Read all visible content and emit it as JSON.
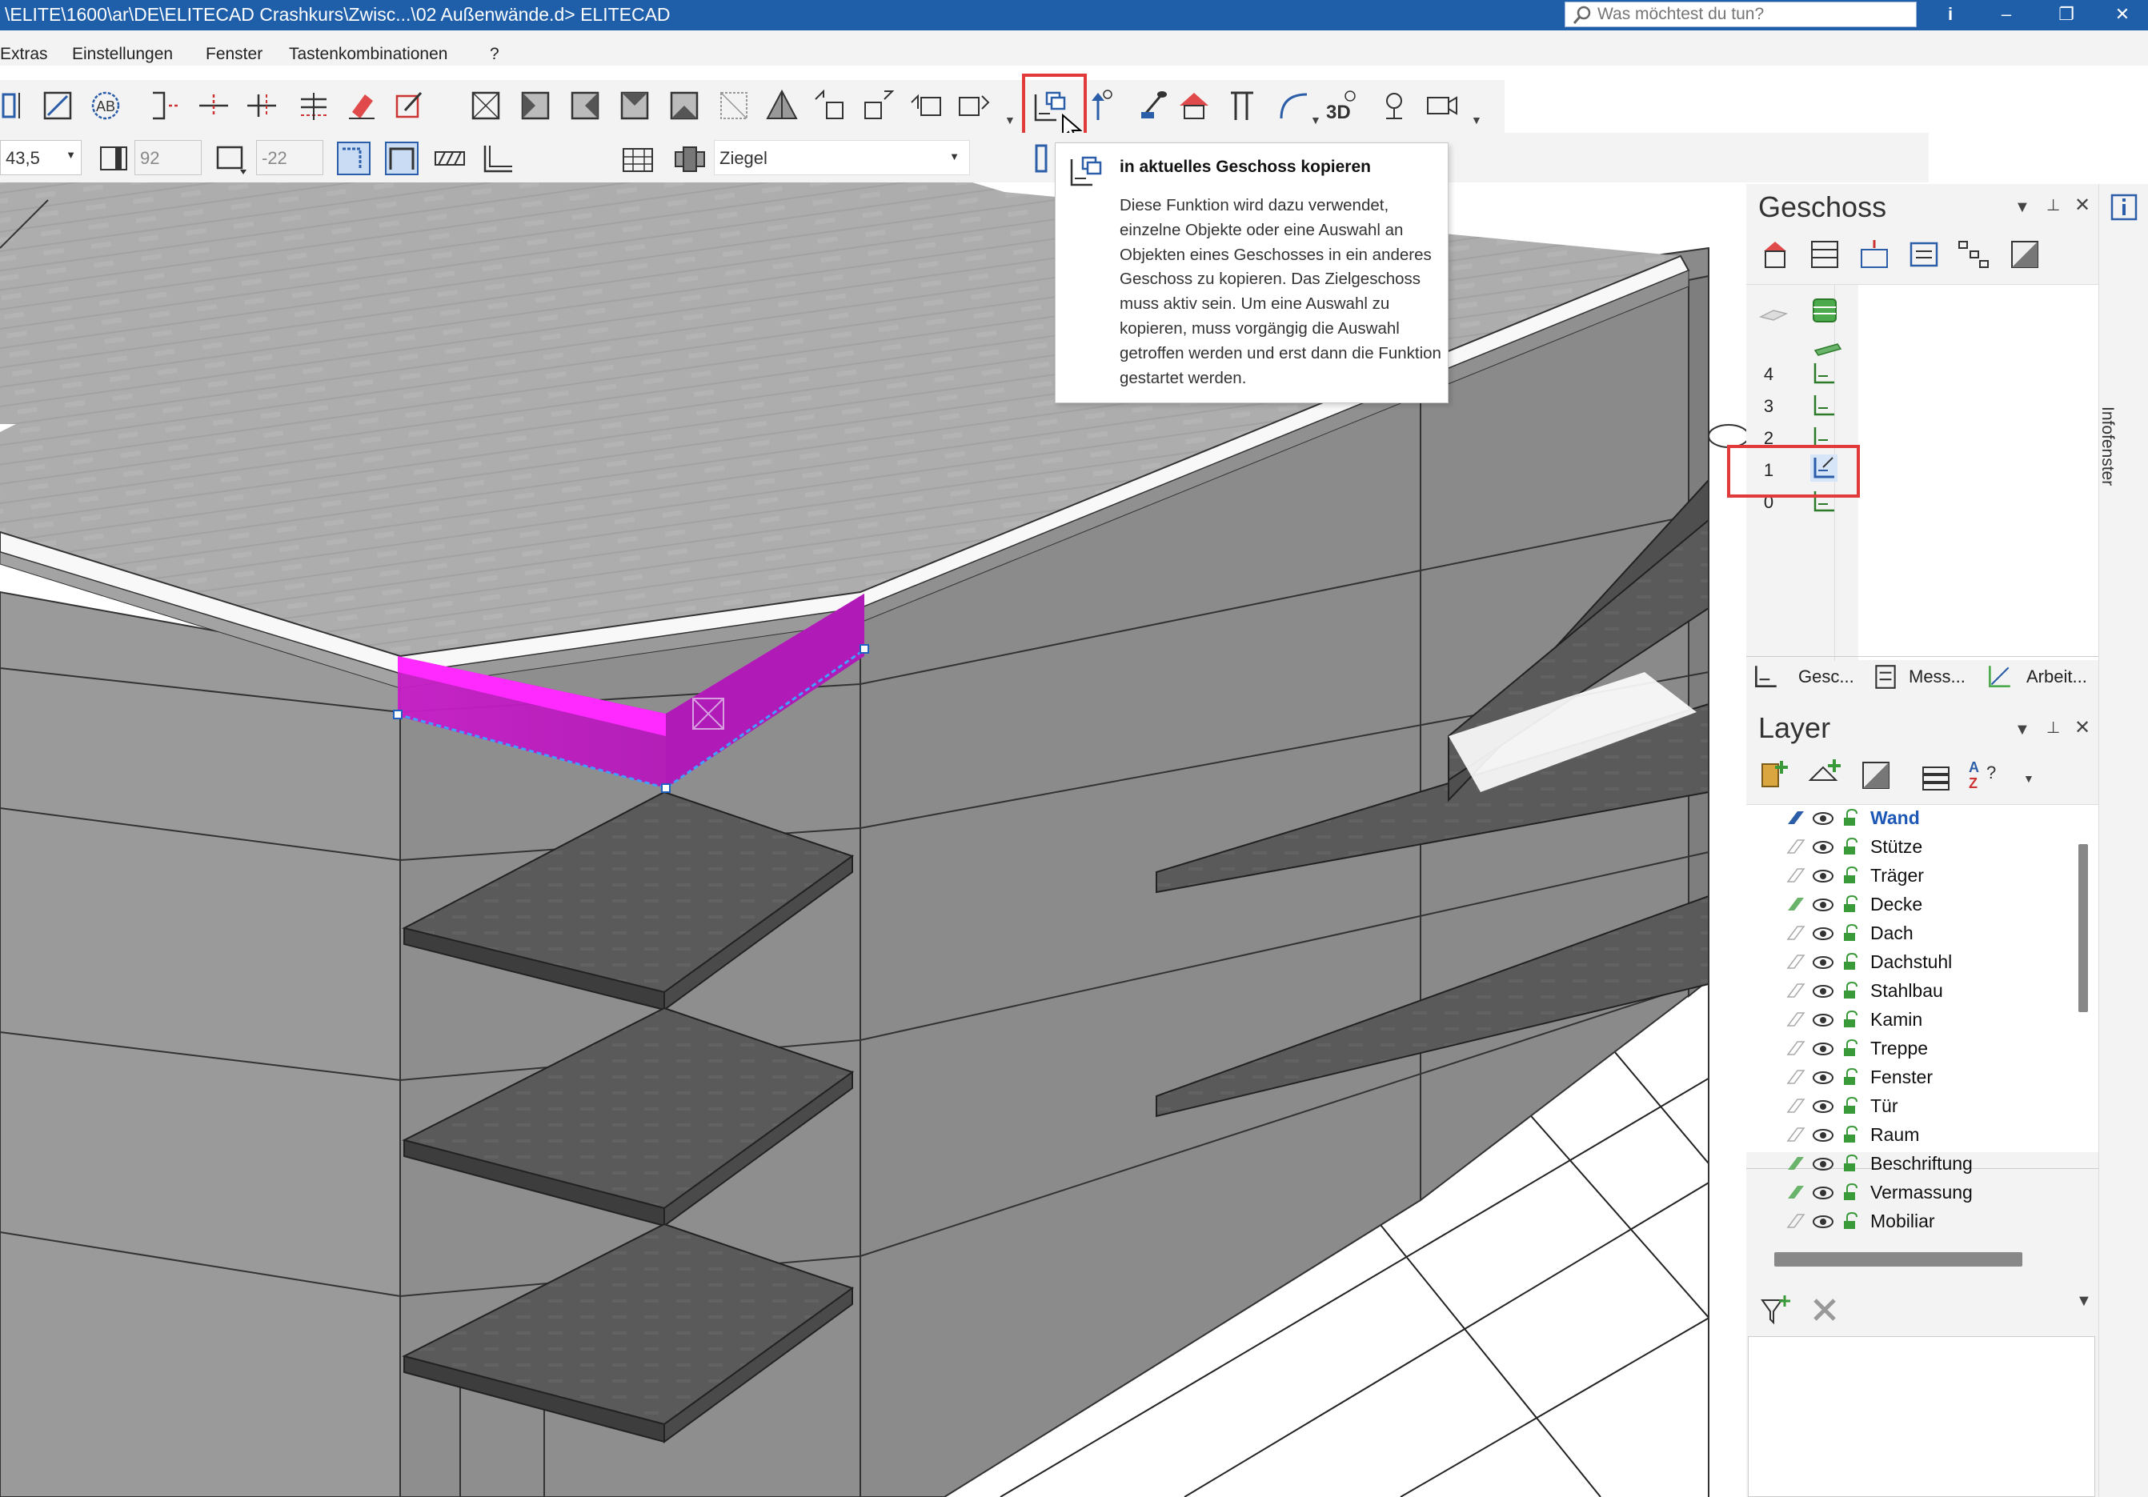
{
  "window": {
    "title": "\\ELITE\\1600\\ar\\DE\\ELITECAD Crashkurs\\Zwisc...\\02 Außenwände.d> ELITECAD",
    "search_placeholder": "Was möchtest du tun?",
    "controls": [
      "i",
      "–",
      "❐",
      "✕"
    ]
  },
  "menu": [
    "Extras",
    "Einstellungen",
    "Fenster",
    "Tastenkombinationen",
    "?"
  ],
  "toolbar2": {
    "field_height": "43,5",
    "field_thickness": "92",
    "field_offset": "-22",
    "material": "Ziegel"
  },
  "tooltip": {
    "title": "in aktuelles Geschoss kopieren",
    "body": "Diese Funktion wird dazu verwendet, einzelne Objekte oder eine Auswahl an Objekten eines Geschosses in ein anderes Geschoss zu kopieren. Das Zielgeschoss muss aktiv sein. Um eine Auswahl zu kopieren, muss vorgängig die Auswahl getroffen werden und erst dann die Funktion gestartet werden."
  },
  "geschoss_panel": {
    "title": "Geschoss",
    "floors": [
      "4",
      "3",
      "2",
      "1",
      "0"
    ],
    "active_floor": "1",
    "tabs": [
      "Gesc...",
      "Mess...",
      "Arbeit..."
    ]
  },
  "layer_panel": {
    "title": "Layer",
    "layers": [
      "Wand",
      "Stütze",
      "Träger",
      "Decke",
      "Dach",
      "Dachstuhl",
      "Stahlbau",
      "Kamin",
      "Treppe",
      "Fenster",
      "Tür",
      "Raum",
      "Beschriftung",
      "Vermassung",
      "Mobiliar"
    ],
    "active_layer": "Wand"
  },
  "side_tab": "Infofenster",
  "colors": {
    "titlebar": "#1f5faa",
    "highlight_wall": "#ff20ff",
    "red_marker": "#e03a3a",
    "active_layer": "#1d58b7"
  }
}
